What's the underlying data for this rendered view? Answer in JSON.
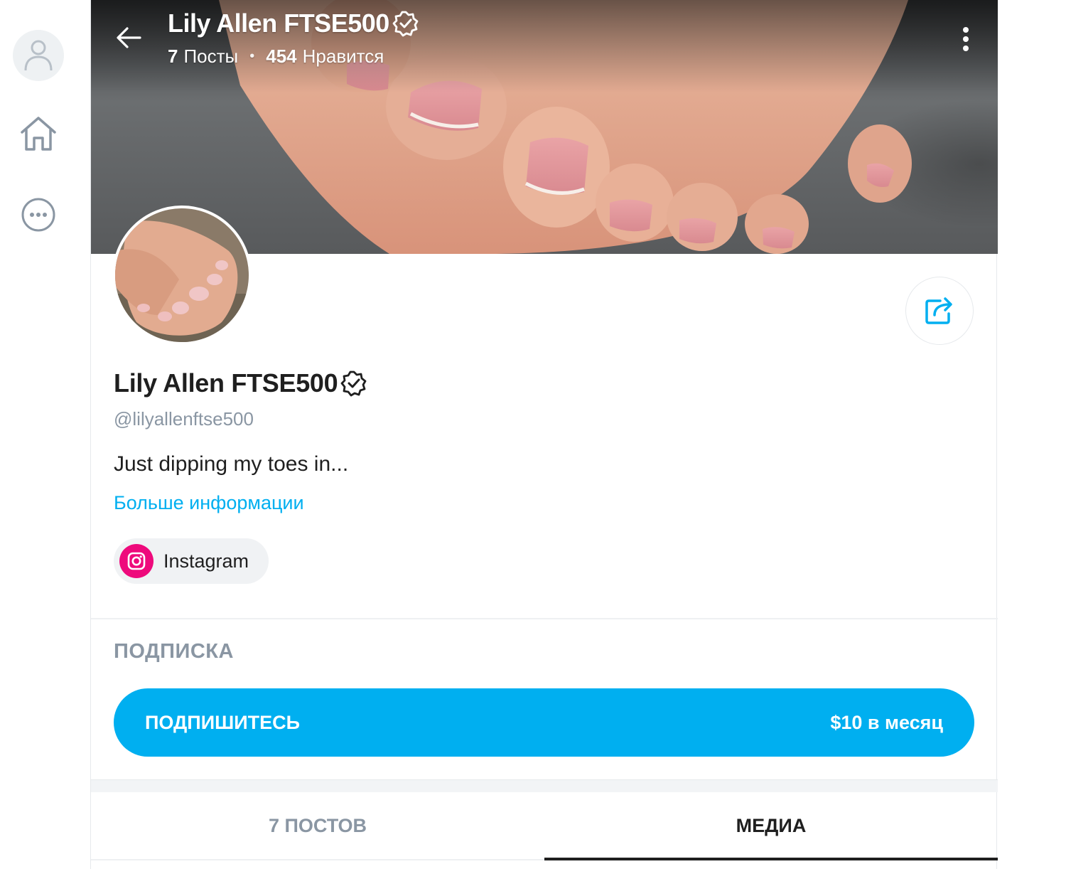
{
  "header": {
    "title": "Lily Allen FTSE500",
    "posts_count": "7",
    "posts_label": "Посты",
    "likes_count": "454",
    "likes_label": "Нравится",
    "separator": "•"
  },
  "profile": {
    "name": "Lily Allen FTSE500",
    "handle": "@lilyallenftse500",
    "bio": "Just dipping my toes in...",
    "more_info_label": "Больше информации",
    "social_links": [
      {
        "label": "Instagram",
        "icon": "instagram-icon"
      }
    ]
  },
  "subscription": {
    "section_title": "ПОДПИСКА",
    "button_label": "ПОДПИШИТЕСЬ",
    "price_label": "$10 в месяц"
  },
  "tabs": [
    {
      "label": "7 ПОСТОВ",
      "active": false
    },
    {
      "label": "МЕДИА",
      "active": true
    }
  ],
  "nav": {
    "items": [
      {
        "icon": "user-avatar-icon"
      },
      {
        "icon": "home-icon"
      },
      {
        "icon": "more-icon"
      }
    ]
  },
  "colors": {
    "accent": "#00aff0",
    "instagram": "#ee0a7c",
    "muted_text": "#8a96a3",
    "text": "#1f1f1f"
  }
}
